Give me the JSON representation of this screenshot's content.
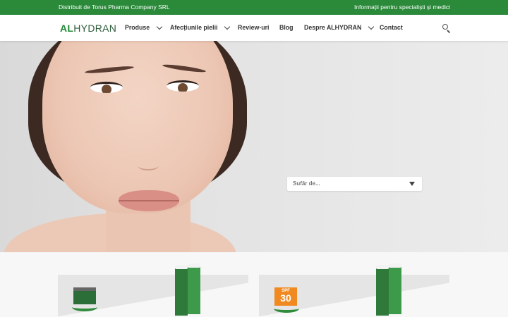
{
  "topbar": {
    "distributor": "Distribuit de Torus Pharma Company SRL",
    "specialists_link": "Informații pentru specialiști și medici"
  },
  "nav": {
    "logo_prefix": "AL",
    "logo_suffix": "HYDRAN",
    "items": [
      {
        "label": "Produse",
        "has_dropdown": true
      },
      {
        "label": "Afecțiunile pielii",
        "has_dropdown": true
      },
      {
        "label": "Review-uri",
        "has_dropdown": false
      },
      {
        "label": "Blog",
        "has_dropdown": false
      },
      {
        "label": "Despre ALHYDRAN",
        "has_dropdown": true
      },
      {
        "label": "Contact",
        "has_dropdown": false
      }
    ],
    "search_icon": "search-icon"
  },
  "hero": {
    "select_value": "Sufăr de..."
  },
  "products": {
    "badge_spf_label": "SPF",
    "badge_spf_value": "30"
  },
  "colors": {
    "brand_green": "#2a8a3a",
    "logo_dark_green": "#2d5d3a",
    "spf_orange": "#f08a20"
  }
}
